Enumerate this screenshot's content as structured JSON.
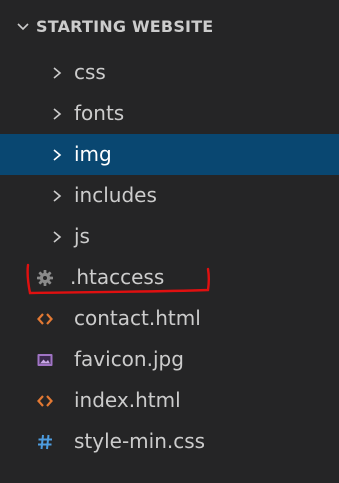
{
  "explorer": {
    "section_title": "STARTING WEBSITE",
    "folders": [
      {
        "label": "css",
        "icon": "chevron-right-icon"
      },
      {
        "label": "fonts",
        "icon": "chevron-right-icon"
      },
      {
        "label": "img",
        "icon": "chevron-right-icon",
        "selected": true
      },
      {
        "label": "includes",
        "icon": "chevron-right-icon"
      },
      {
        "label": "js",
        "icon": "chevron-right-icon"
      }
    ],
    "files": [
      {
        "label": ".htaccess",
        "icon": "gear-icon"
      },
      {
        "label": "contact.html",
        "icon": "html-file-icon"
      },
      {
        "label": "favicon.jpg",
        "icon": "image-file-icon"
      },
      {
        "label": "index.html",
        "icon": "html-file-icon"
      },
      {
        "label": "style-min.css",
        "icon": "css-hash-icon"
      }
    ],
    "colors": {
      "background": "#252526",
      "selected_row": "#094771",
      "text": "#cccccc",
      "html_icon": "#e37933",
      "image_icon": "#a074c4",
      "css_icon": "#4d9de0",
      "gear_icon": "#8a8a8a",
      "annotation": "#e01010"
    }
  }
}
